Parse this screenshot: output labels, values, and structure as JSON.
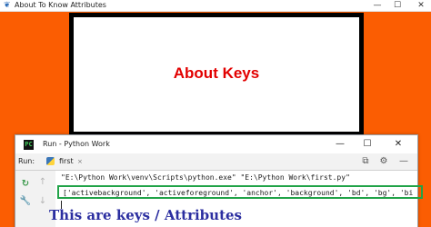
{
  "tk_window": {
    "title": "About To Know Attributes",
    "icon": "feather-icon",
    "controls": {
      "minimize": "—",
      "maximize": "☐",
      "close": "✕"
    },
    "background_color": "#fb5d02"
  },
  "label": {
    "text": "About Keys",
    "text_color": "#e20000",
    "background_color": "#ffffff",
    "border_color": "#000000"
  },
  "run_window": {
    "title": "Run - Python Work",
    "icon": "pycharm-icon",
    "controls": {
      "minimize": "—",
      "maximize": "☐",
      "close": "✕"
    },
    "toolbar": {
      "run_label": "Run:",
      "tab_label": "first",
      "tab_close": "×",
      "icons": [
        "restore-layout-icon",
        "settings-icon",
        "hide-icon"
      ]
    },
    "side_icons": [
      "rerun-icon",
      "wrench-icon",
      "up-arrow-icon",
      "down-arrow-icon"
    ],
    "console": {
      "command": "\"E:\\Python Work\\venv\\Scripts\\python.exe\" \"E:\\Python Work\\first.py\"",
      "output": "['activebackground', 'activeforeground', 'anchor', 'background', 'bd', 'bg', 'bi"
    }
  },
  "annotation": {
    "text": "This are keys / Attributes",
    "color": "#2b2ea0",
    "highlight_color": "#21a348"
  }
}
